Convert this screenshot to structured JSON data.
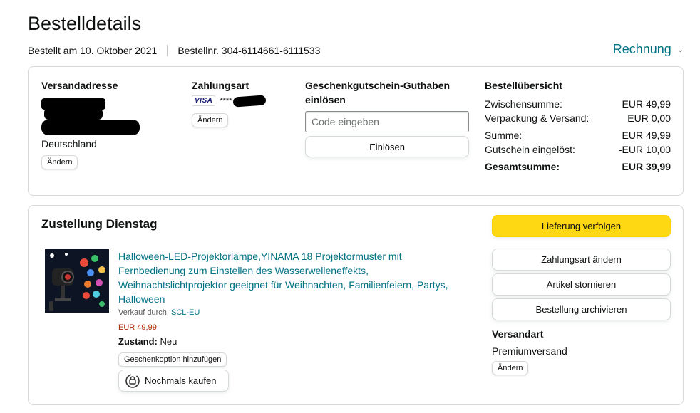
{
  "header": {
    "title": "Bestelldetails",
    "ordered_on": "Bestellt am 10. Oktober 2021",
    "order_number": "Bestellnr. 304-6114661-6111533",
    "invoice_label": "Rechnung"
  },
  "shipping_address": {
    "heading": "Versandadresse",
    "country": "Deutschland",
    "change_label": "Ändern"
  },
  "payment": {
    "heading": "Zahlungsart",
    "card_brand": "VISA",
    "masked": "****",
    "change_label": "Ändern"
  },
  "giftcard": {
    "heading_line1": "Geschenkgutschein-Guthaben",
    "heading_line2": "einlösen",
    "placeholder": "Code eingeben",
    "redeem_label": "Einlösen"
  },
  "order_summary": {
    "heading": "Bestellübersicht",
    "rows": [
      {
        "label": "Zwischensumme:",
        "value": "EUR 49,99"
      },
      {
        "label": "Verpackung & Versand:",
        "value": "EUR 0,00"
      },
      {
        "label": "Summe:",
        "value": "EUR 49,99"
      },
      {
        "label": "Gutschein eingelöst:",
        "value": "-EUR 10,00"
      }
    ],
    "total_label": "Gesamtsumme:",
    "total_value": "EUR 39,99"
  },
  "delivery": {
    "heading": "Zustellung Dienstag",
    "product_title": "Halloween-LED-Projektorlampe,YINAMA 18 Projektormuster mit Fernbedienung zum Einstellen des Wasserwelleneffekts, Weihnachtslichtprojektor geeignet für Weihnachten, Familienfeiern, Partys, Halloween",
    "sold_by_label": "Verkauf durch:",
    "seller": "SCL-EU",
    "price": "EUR 49,99",
    "condition_label": "Zustand:",
    "condition": "Neu",
    "gift_option_label": "Geschenkoption hinzufügen",
    "buy_again_label": "Nochmals kaufen"
  },
  "actions": {
    "track": "Lieferung verfolgen",
    "change_payment": "Zahlungsart ändern",
    "cancel": "Artikel stornieren",
    "archive": "Bestellung archivieren"
  },
  "shipping_method": {
    "heading": "Versandart",
    "value": "Premiumversand",
    "change_label": "Ändern"
  },
  "colors": {
    "link": "#007185",
    "price": "#b12704",
    "track_button": "#ffd814",
    "border": "#d5d9d9"
  }
}
